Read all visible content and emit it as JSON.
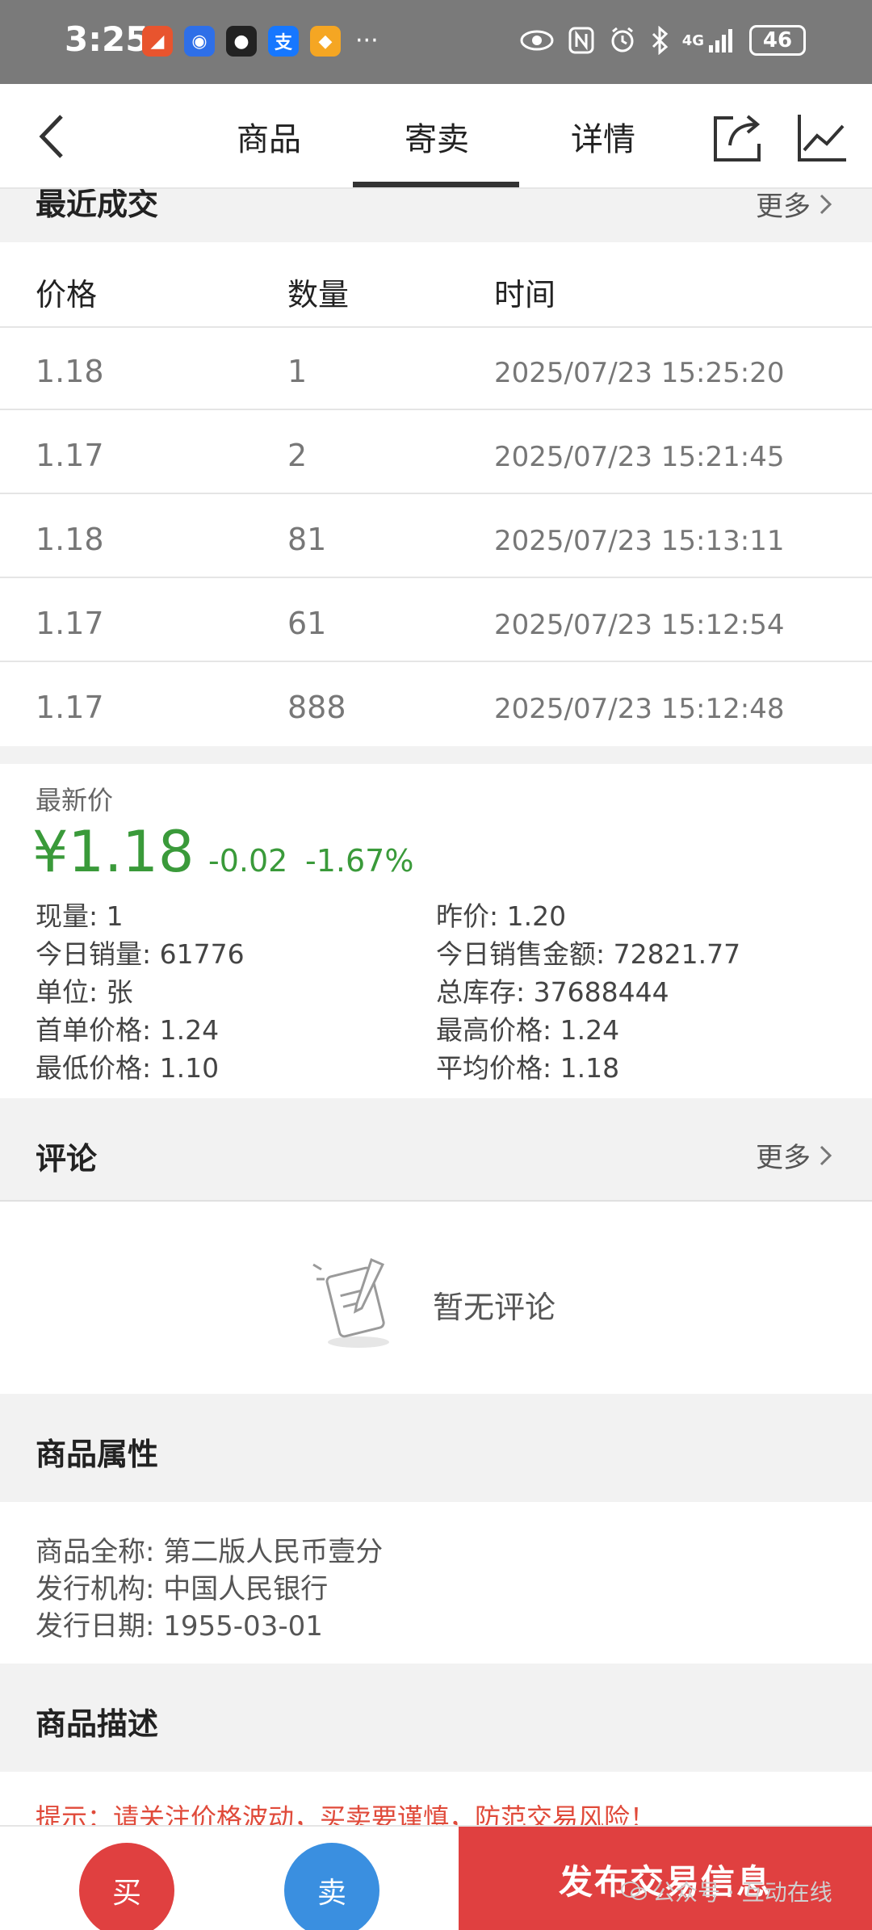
{
  "status_bar": {
    "time": "3:25",
    "battery": "46",
    "network": "4G",
    "more": "···",
    "app_icons": [
      {
        "name": "app-icon-1",
        "color": "#e8542e",
        "glyph": "◢"
      },
      {
        "name": "app-icon-2",
        "color": "#2e6fe8",
        "glyph": "◉"
      },
      {
        "name": "qq-icon",
        "color": "#222222",
        "glyph": "●"
      },
      {
        "name": "alipay-icon",
        "color": "#1677ff",
        "glyph": "支"
      },
      {
        "name": "app-icon-5",
        "color": "#f5a623",
        "glyph": "◆"
      }
    ]
  },
  "nav": {
    "tabs": [
      "商品",
      "寄卖",
      "详情"
    ],
    "active_tab": "寄卖"
  },
  "recent_trades": {
    "title": "最近成交",
    "more": "更多",
    "headers": [
      "价格",
      "数量",
      "时间"
    ],
    "rows": [
      {
        "price": "1.18",
        "qty": "1",
        "time": "2025/07/23 15:25:20"
      },
      {
        "price": "1.17",
        "qty": "2",
        "time": "2025/07/23 15:21:45"
      },
      {
        "price": "1.18",
        "qty": "81",
        "time": "2025/07/23 15:13:11"
      },
      {
        "price": "1.17",
        "qty": "61",
        "time": "2025/07/23 15:12:54"
      },
      {
        "price": "1.17",
        "qty": "888",
        "time": "2025/07/23 15:12:48"
      }
    ]
  },
  "latest": {
    "label": "最新价",
    "price": "¥1.18",
    "change": "-0.02",
    "change_pct": "-1.67%",
    "price_color": "#3a9a3a",
    "stats_left": [
      "现量: 1",
      "今日销量: 61776",
      "单位: 张",
      "首单价格:  1.24",
      "最低价格:  1.10"
    ],
    "stats_right": [
      "昨价: 1.20",
      "今日销售金额: 72821.77",
      "总库存: 37688444",
      "最高价格:  1.24",
      "平均价格:  1.18"
    ]
  },
  "comments": {
    "title": "评论",
    "more": "更多",
    "empty_text": "暂无评论"
  },
  "attributes": {
    "title": "商品属性",
    "items": [
      "商品全称: 第二版人民币壹分",
      "发行机构: 中国人民银行",
      "发行日期: 1955-03-01"
    ]
  },
  "description": {
    "title": "商品描述",
    "hint": "提示：请关注价格波动，买卖要谨慎，防范交易风险！"
  },
  "bottom": {
    "buy": "买",
    "sell": "卖",
    "publish": "发布交易信息",
    "buy_color": "#e04040",
    "sell_color": "#3a8fe0"
  },
  "watermark": "公众号 · 互动在线"
}
